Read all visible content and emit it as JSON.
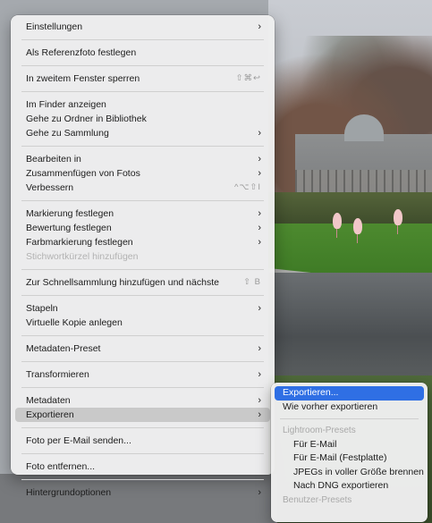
{
  "menu": {
    "groups": [
      [
        {
          "label": "Einstellungen",
          "arrow": "›"
        }
      ],
      [
        {
          "label": "Als Referenzfoto festlegen"
        }
      ],
      [
        {
          "label": "In zweitem Fenster sperren",
          "shortcut": "⇧⌘↩"
        }
      ],
      [
        {
          "label": "Im Finder anzeigen"
        },
        {
          "label": "Gehe zu Ordner in Bibliothek"
        },
        {
          "label": "Gehe zu Sammlung",
          "arrow": "›"
        }
      ],
      [
        {
          "label": "Bearbeiten in",
          "arrow": "›"
        },
        {
          "label": "Zusammenfügen von Fotos",
          "arrow": "›"
        },
        {
          "label": "Verbessern",
          "shortcut": "^⌥⇧I"
        }
      ],
      [
        {
          "label": "Markierung festlegen",
          "arrow": "›"
        },
        {
          "label": "Bewertung festlegen",
          "arrow": "›"
        },
        {
          "label": "Farbmarkierung festlegen",
          "arrow": "›"
        },
        {
          "label": "Stichwortkürzel hinzufügen",
          "disabled": true
        }
      ],
      [
        {
          "label": "Zur Schnellsammlung hinzufügen und nächste",
          "shortcut": "⇧ B"
        }
      ],
      [
        {
          "label": "Stapeln",
          "arrow": "›"
        },
        {
          "label": "Virtuelle Kopie anlegen"
        }
      ],
      [
        {
          "label": "Metadaten-Preset",
          "arrow": "›"
        }
      ],
      [
        {
          "label": "Transformieren",
          "arrow": "›"
        }
      ],
      [
        {
          "label": "Metadaten",
          "arrow": "›"
        },
        {
          "label": "Exportieren",
          "arrow": "›",
          "selected": true
        }
      ],
      [
        {
          "label": "Foto per E-Mail senden..."
        }
      ],
      [
        {
          "label": "Foto entfernen..."
        }
      ],
      [
        {
          "label": "Hintergrundoptionen",
          "arrow": "›"
        }
      ]
    ]
  },
  "submenu": {
    "groups": [
      [
        {
          "label": "Exportieren...",
          "highlight": true
        },
        {
          "label": "Wie vorher exportieren"
        }
      ],
      [
        {
          "label": "Lightroom-Presets",
          "header": true
        },
        {
          "label": "Für E-Mail",
          "indent": true
        },
        {
          "label": "Für E-Mail (Festplatte)",
          "indent": true
        },
        {
          "label": "JPEGs in voller Größe brennen",
          "indent": true
        },
        {
          "label": "Nach DNG exportieren",
          "indent": true
        },
        {
          "label": "Benutzer-Presets",
          "header": true
        }
      ]
    ]
  }
}
